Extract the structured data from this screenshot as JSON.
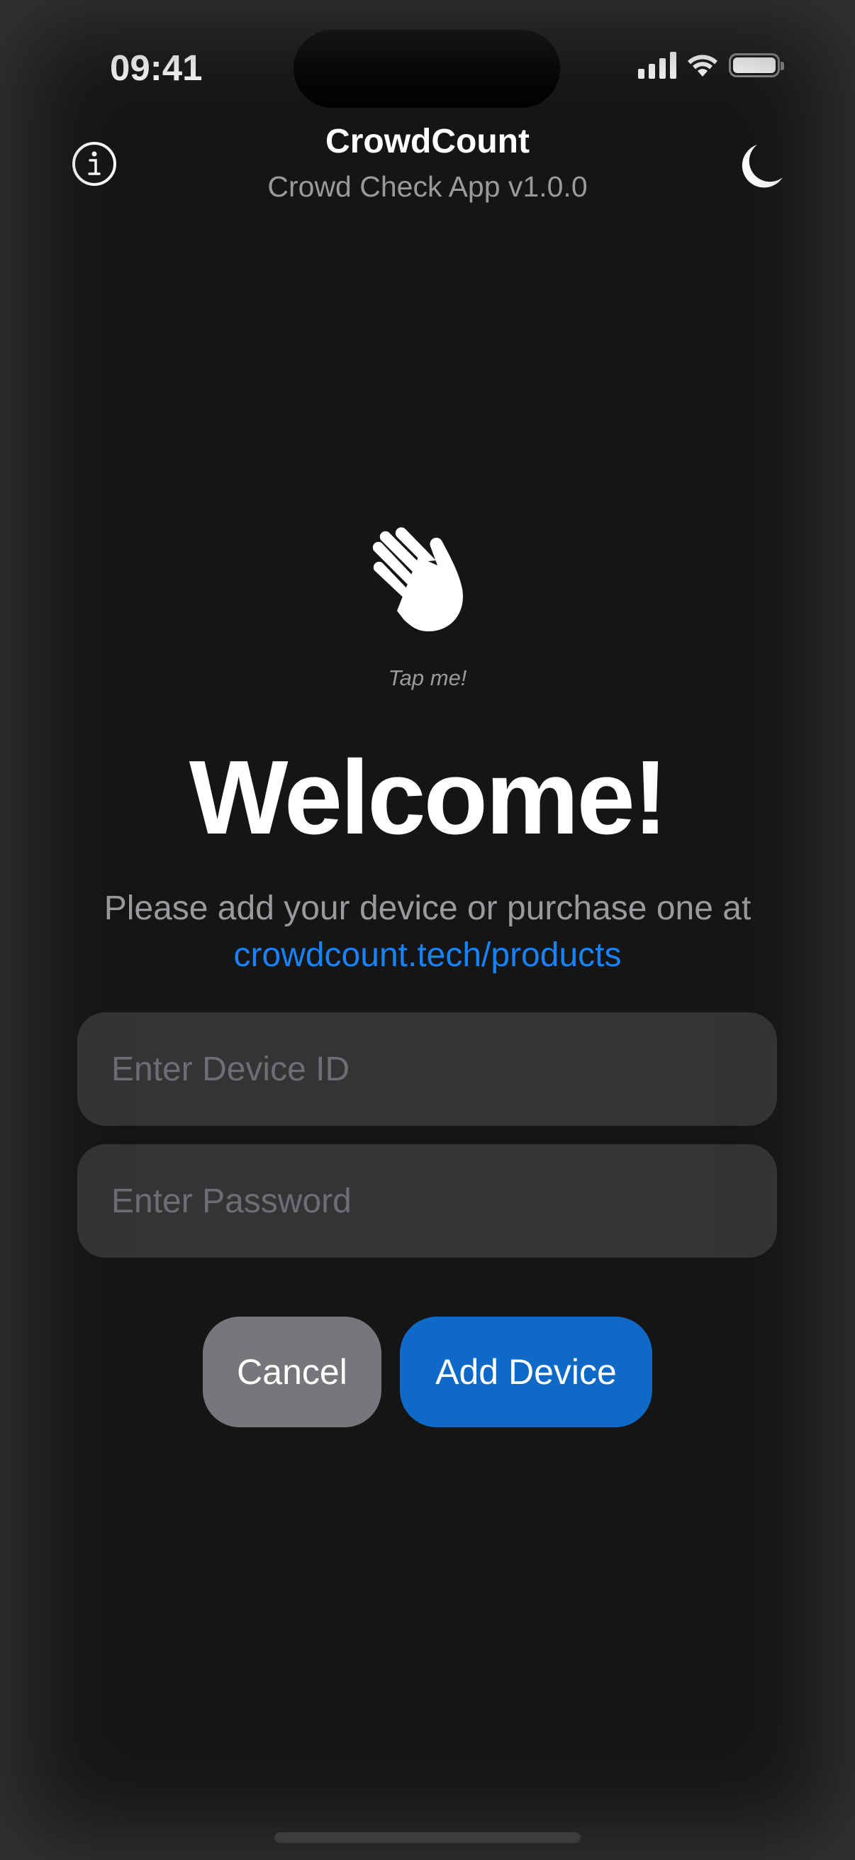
{
  "status_bar": {
    "time": "09:41",
    "icons": [
      "cellular-signal-icon",
      "wifi-icon",
      "battery-icon"
    ]
  },
  "header": {
    "title": "CrowdCount",
    "subtitle": "Crowd Check App v1.0.0",
    "left_icon": "info-circle-icon",
    "right_icon": "moon-icon"
  },
  "main": {
    "wave_icon": "waving-hand-icon",
    "tap_hint": "Tap me!",
    "welcome": "Welcome!",
    "prompt_text": "Please add your device or purchase one at",
    "link_text": "crowdcount.tech/products",
    "device_id_field": {
      "value": "",
      "placeholder": "Enter Device ID"
    },
    "password_field": {
      "value": "",
      "placeholder": "Enter Password"
    },
    "cancel_label": "Cancel",
    "add_label": "Add Device"
  },
  "colors": {
    "background": "#151515",
    "field": "#343436",
    "link": "#1a82f7",
    "primary_button": "#0f69c6",
    "secondary_button": "#77767b",
    "secondary_text": "#9a9a9e"
  }
}
